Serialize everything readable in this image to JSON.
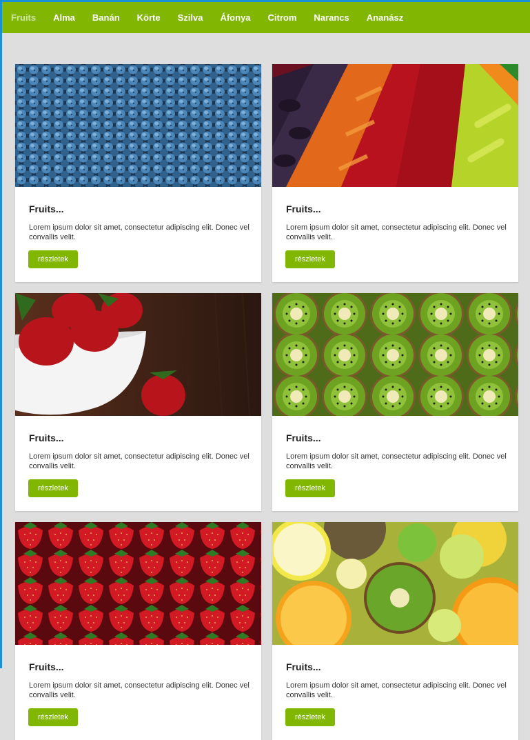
{
  "nav": {
    "items": [
      {
        "label": "Fruits",
        "active": true
      },
      {
        "label": "Alma"
      },
      {
        "label": "Banán"
      },
      {
        "label": "Körte"
      },
      {
        "label": "Szilva"
      },
      {
        "label": "Áfonya"
      },
      {
        "label": "Citrom"
      },
      {
        "label": "Narancs"
      },
      {
        "label": "Ananász"
      }
    ]
  },
  "colors": {
    "accent": "#81b603",
    "page_bg": "#dedede",
    "frame": "#1a8fd6"
  },
  "cards": [
    {
      "image": "blueberries-photo",
      "title": "Fruits...",
      "text": "Lorem ipsum dolor sit amet, consectetur adipiscing elit. Donec vel convallis velit.",
      "button": "részletek"
    },
    {
      "image": "vegetable-market-photo",
      "title": "Fruits...",
      "text": "Lorem ipsum dolor sit amet, consectetur adipiscing elit. Donec vel convallis velit.",
      "button": "részletek"
    },
    {
      "image": "strawberry-bowl-photo",
      "title": "Fruits...",
      "text": "Lorem ipsum dolor sit amet, consectetur adipiscing elit. Donec vel convallis velit.",
      "button": "részletek"
    },
    {
      "image": "kiwi-slices-photo",
      "title": "Fruits...",
      "text": "Lorem ipsum dolor sit amet, consectetur adipiscing elit. Donec vel convallis velit.",
      "button": "részletek"
    },
    {
      "image": "strawberries-photo",
      "title": "Fruits...",
      "text": "Lorem ipsum dolor sit amet, consectetur adipiscing elit. Donec vel convallis velit.",
      "button": "részletek"
    },
    {
      "image": "citrus-kiwi-photo",
      "title": "Fruits...",
      "text": "Lorem ipsum dolor sit amet, consectetur adipiscing elit. Donec vel convallis velit.",
      "button": "részletek"
    }
  ]
}
